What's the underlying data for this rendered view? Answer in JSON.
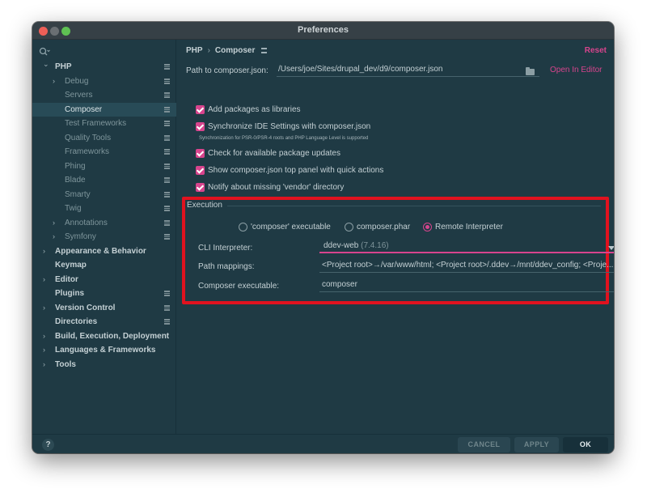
{
  "window": {
    "title": "Preferences"
  },
  "sidebar": {
    "search_icon": "search-icon",
    "items": [
      {
        "label": "PHP",
        "level": 0,
        "arrow": "open",
        "bold": true,
        "options": true
      },
      {
        "label": "Debug",
        "level": 1,
        "arrow": "closed",
        "options": true
      },
      {
        "label": "Servers",
        "level": 1,
        "options": true
      },
      {
        "label": "Composer",
        "level": 1,
        "selected": true,
        "options": true
      },
      {
        "label": "Test Frameworks",
        "level": 1,
        "options": true
      },
      {
        "label": "Quality Tools",
        "level": 1,
        "options": true
      },
      {
        "label": "Frameworks",
        "level": 1,
        "options": true
      },
      {
        "label": "Phing",
        "level": 1,
        "options": true
      },
      {
        "label": "Blade",
        "level": 1,
        "options": true
      },
      {
        "label": "Smarty",
        "level": 1,
        "options": true
      },
      {
        "label": "Twig",
        "level": 1,
        "options": true
      },
      {
        "label": "Annotations",
        "level": 1,
        "arrow": "closed",
        "options": true
      },
      {
        "label": "Symfony",
        "level": 1,
        "arrow": "closed",
        "options": true
      },
      {
        "label": "Appearance & Behavior",
        "level": 0,
        "arrow": "closed",
        "bold": true
      },
      {
        "label": "Keymap",
        "level": 0,
        "bold": true
      },
      {
        "label": "Editor",
        "level": 0,
        "arrow": "closed",
        "bold": true
      },
      {
        "label": "Plugins",
        "level": 0,
        "bold": true,
        "options": true
      },
      {
        "label": "Version Control",
        "level": 0,
        "arrow": "closed",
        "bold": true,
        "options": true
      },
      {
        "label": "Directories",
        "level": 0,
        "bold": true,
        "options": true
      },
      {
        "label": "Build, Execution, Deployment",
        "level": 0,
        "arrow": "closed",
        "bold": true
      },
      {
        "label": "Languages & Frameworks",
        "level": 0,
        "arrow": "closed",
        "bold": true
      },
      {
        "label": "Tools",
        "level": 0,
        "arrow": "closed",
        "bold": true
      }
    ]
  },
  "header": {
    "crumb1": "PHP",
    "separator": "›",
    "crumb2": "Composer",
    "reset": "Reset"
  },
  "composer": {
    "path_label": "Path to composer.json:",
    "path_value": "/Users/joe/Sites/drupal_dev/d9/composer.json",
    "open_in_editor": "Open In Editor",
    "options": [
      {
        "label": "Add packages as libraries",
        "checked": true
      },
      {
        "label": "Synchronize IDE Settings with composer.json",
        "checked": true
      },
      {
        "label": "Check for available package updates",
        "checked": true
      },
      {
        "label": "Show composer.json top panel with quick actions",
        "checked": true
      },
      {
        "label": "Notify about missing 'vendor' directory",
        "checked": true
      }
    ],
    "sync_note": "Synchronization for PSR-0/PSR-4 roots and PHP Language Level is supported"
  },
  "execution": {
    "title": "Execution",
    "radios": [
      {
        "label": "'composer' executable",
        "selected": false
      },
      {
        "label": "composer.phar",
        "selected": false
      },
      {
        "label": "Remote Interpreter",
        "selected": true
      }
    ],
    "cli_label": "CLI Interpreter:",
    "cli_value": "ddev-web",
    "cli_version": "(7.4.16)",
    "more": "...",
    "path_mappings_label": "Path mappings:",
    "path_mappings_value": "<Project root>→/var/www/html; <Project root>/.ddev→/mnt/ddev_config; <Proje...",
    "composer_exec_label": "Composer executable:",
    "composer_exec_value": "composer",
    "highlight_color": "#e0121f"
  },
  "footer": {
    "help": "?",
    "cancel": "CANCEL",
    "apply": "APPLY",
    "ok": "OK"
  },
  "colors": {
    "accent": "#d7448d",
    "background": "#1f3a44",
    "selection": "#284b57"
  }
}
